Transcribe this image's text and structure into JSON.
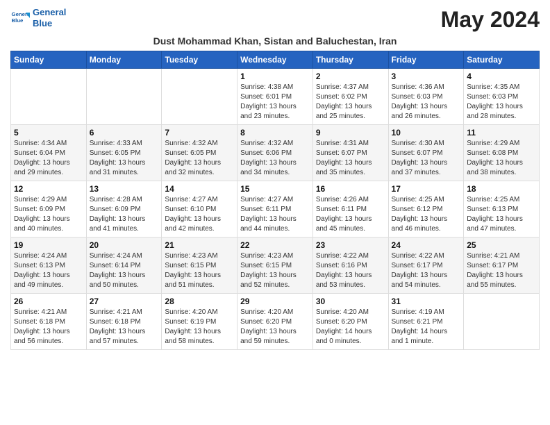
{
  "header": {
    "logo_line1": "General",
    "logo_line2": "Blue",
    "month_title": "May 2024",
    "subtitle": "Dust Mohammad Khan, Sistan and Baluchestan, Iran"
  },
  "weekdays": [
    "Sunday",
    "Monday",
    "Tuesday",
    "Wednesday",
    "Thursday",
    "Friday",
    "Saturday"
  ],
  "weeks": [
    [
      {
        "day": "",
        "info": ""
      },
      {
        "day": "",
        "info": ""
      },
      {
        "day": "",
        "info": ""
      },
      {
        "day": "1",
        "info": "Sunrise: 4:38 AM\nSunset: 6:01 PM\nDaylight: 13 hours\nand 23 minutes."
      },
      {
        "day": "2",
        "info": "Sunrise: 4:37 AM\nSunset: 6:02 PM\nDaylight: 13 hours\nand 25 minutes."
      },
      {
        "day": "3",
        "info": "Sunrise: 4:36 AM\nSunset: 6:03 PM\nDaylight: 13 hours\nand 26 minutes."
      },
      {
        "day": "4",
        "info": "Sunrise: 4:35 AM\nSunset: 6:03 PM\nDaylight: 13 hours\nand 28 minutes."
      }
    ],
    [
      {
        "day": "5",
        "info": "Sunrise: 4:34 AM\nSunset: 6:04 PM\nDaylight: 13 hours\nand 29 minutes."
      },
      {
        "day": "6",
        "info": "Sunrise: 4:33 AM\nSunset: 6:05 PM\nDaylight: 13 hours\nand 31 minutes."
      },
      {
        "day": "7",
        "info": "Sunrise: 4:32 AM\nSunset: 6:05 PM\nDaylight: 13 hours\nand 32 minutes."
      },
      {
        "day": "8",
        "info": "Sunrise: 4:32 AM\nSunset: 6:06 PM\nDaylight: 13 hours\nand 34 minutes."
      },
      {
        "day": "9",
        "info": "Sunrise: 4:31 AM\nSunset: 6:07 PM\nDaylight: 13 hours\nand 35 minutes."
      },
      {
        "day": "10",
        "info": "Sunrise: 4:30 AM\nSunset: 6:07 PM\nDaylight: 13 hours\nand 37 minutes."
      },
      {
        "day": "11",
        "info": "Sunrise: 4:29 AM\nSunset: 6:08 PM\nDaylight: 13 hours\nand 38 minutes."
      }
    ],
    [
      {
        "day": "12",
        "info": "Sunrise: 4:29 AM\nSunset: 6:09 PM\nDaylight: 13 hours\nand 40 minutes."
      },
      {
        "day": "13",
        "info": "Sunrise: 4:28 AM\nSunset: 6:09 PM\nDaylight: 13 hours\nand 41 minutes."
      },
      {
        "day": "14",
        "info": "Sunrise: 4:27 AM\nSunset: 6:10 PM\nDaylight: 13 hours\nand 42 minutes."
      },
      {
        "day": "15",
        "info": "Sunrise: 4:27 AM\nSunset: 6:11 PM\nDaylight: 13 hours\nand 44 minutes."
      },
      {
        "day": "16",
        "info": "Sunrise: 4:26 AM\nSunset: 6:11 PM\nDaylight: 13 hours\nand 45 minutes."
      },
      {
        "day": "17",
        "info": "Sunrise: 4:25 AM\nSunset: 6:12 PM\nDaylight: 13 hours\nand 46 minutes."
      },
      {
        "day": "18",
        "info": "Sunrise: 4:25 AM\nSunset: 6:13 PM\nDaylight: 13 hours\nand 47 minutes."
      }
    ],
    [
      {
        "day": "19",
        "info": "Sunrise: 4:24 AM\nSunset: 6:13 PM\nDaylight: 13 hours\nand 49 minutes."
      },
      {
        "day": "20",
        "info": "Sunrise: 4:24 AM\nSunset: 6:14 PM\nDaylight: 13 hours\nand 50 minutes."
      },
      {
        "day": "21",
        "info": "Sunrise: 4:23 AM\nSunset: 6:15 PM\nDaylight: 13 hours\nand 51 minutes."
      },
      {
        "day": "22",
        "info": "Sunrise: 4:23 AM\nSunset: 6:15 PM\nDaylight: 13 hours\nand 52 minutes."
      },
      {
        "day": "23",
        "info": "Sunrise: 4:22 AM\nSunset: 6:16 PM\nDaylight: 13 hours\nand 53 minutes."
      },
      {
        "day": "24",
        "info": "Sunrise: 4:22 AM\nSunset: 6:17 PM\nDaylight: 13 hours\nand 54 minutes."
      },
      {
        "day": "25",
        "info": "Sunrise: 4:21 AM\nSunset: 6:17 PM\nDaylight: 13 hours\nand 55 minutes."
      }
    ],
    [
      {
        "day": "26",
        "info": "Sunrise: 4:21 AM\nSunset: 6:18 PM\nDaylight: 13 hours\nand 56 minutes."
      },
      {
        "day": "27",
        "info": "Sunrise: 4:21 AM\nSunset: 6:18 PM\nDaylight: 13 hours\nand 57 minutes."
      },
      {
        "day": "28",
        "info": "Sunrise: 4:20 AM\nSunset: 6:19 PM\nDaylight: 13 hours\nand 58 minutes."
      },
      {
        "day": "29",
        "info": "Sunrise: 4:20 AM\nSunset: 6:20 PM\nDaylight: 13 hours\nand 59 minutes."
      },
      {
        "day": "30",
        "info": "Sunrise: 4:20 AM\nSunset: 6:20 PM\nDaylight: 14 hours\nand 0 minutes."
      },
      {
        "day": "31",
        "info": "Sunrise: 4:19 AM\nSunset: 6:21 PM\nDaylight: 14 hours\nand 1 minute."
      },
      {
        "day": "",
        "info": ""
      }
    ]
  ]
}
